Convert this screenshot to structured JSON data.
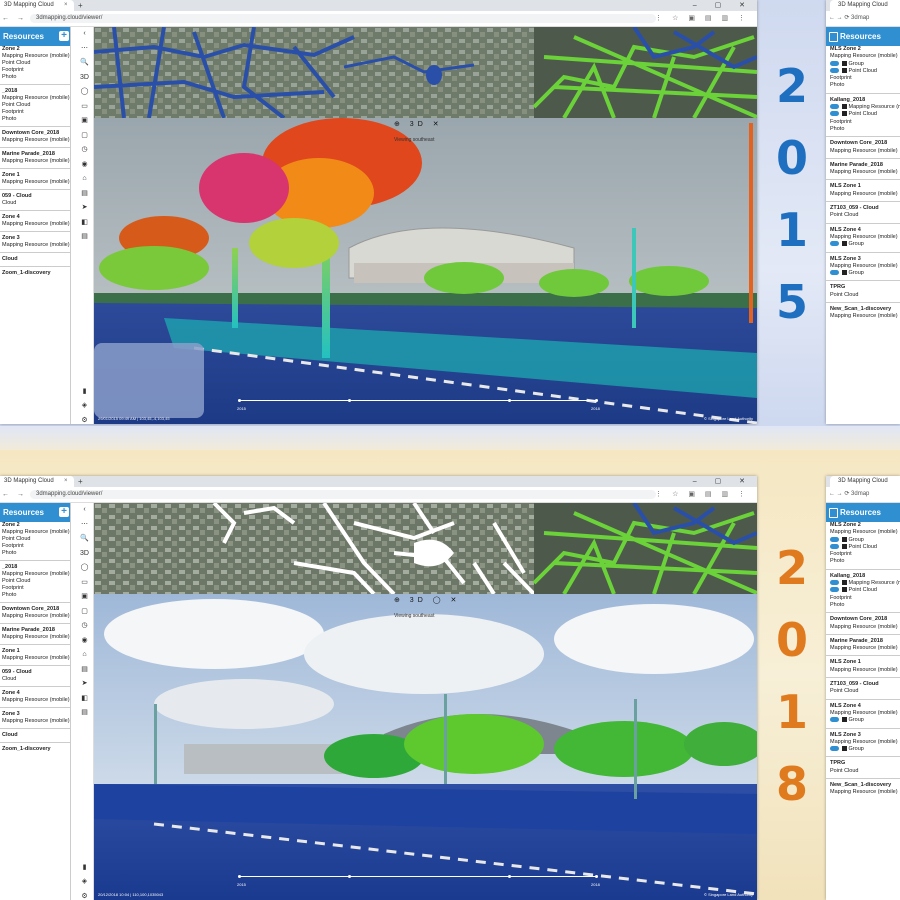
{
  "browser": {
    "tab_title": "3D Mapping Cloud",
    "tab_close": "×",
    "new_tab": "+",
    "window_controls": "– ▢ ✕",
    "nav_buttons": "← → ⟳",
    "url": "3dmapping.cloud/viewer/",
    "extension_icons": "⋮ ☆ ▣ ▤ ▥ ⋮"
  },
  "right_browser": {
    "tab_title": "3D Mapping Cloud",
    "nav_buttons": "← → ⟳",
    "url": "3dmap"
  },
  "left_panel": {
    "header": "Resources",
    "add_button": "+",
    "items": [
      "Zone 2",
      "Mapping Resource (mobile)",
      "Point Cloud",
      "Footprint",
      "Photo",
      "_2018",
      "Mapping Resource (mobile)",
      "Point Cloud",
      "Footprint",
      "Photo",
      "Downtown Core_2018",
      "Mapping Resource (mobile)",
      "Marine Parade_2018",
      "Mapping Resource (mobile)",
      "Zone 1",
      "Mapping Resource (mobile)",
      "059 - Cloud",
      "Cloud",
      "Zone 4",
      "Mapping Resource (mobile)",
      "Zone 3",
      "Mapping Resource (mobile)",
      "Cloud",
      "Zoom_1-discovery"
    ]
  },
  "toolbar": {
    "items": [
      "‹",
      "⋯",
      "🔍",
      "3D",
      "◯",
      "▭",
      "▣",
      "▢",
      "◷",
      "◉",
      "⌂",
      "▤",
      "➤",
      "◧",
      "▤"
    ],
    "bottom_items": [
      "▮",
      "◈",
      "⚙",
      "▯"
    ]
  },
  "views": [
    {
      "year_digits": [
        "2",
        "0",
        "1",
        "5"
      ],
      "year_color": "#1f6fc0",
      "view_controls": "⊕  3D  ✕",
      "view_label": "Viewing southeast",
      "timeline_start": "2015",
      "timeline_end": "2018",
      "timestamp": "29/01/2015 09:49 AM | 103,45,-4,103,45",
      "copyright": "© Singapore Land Authority"
    },
    {
      "year_digits": [
        "2",
        "0",
        "1",
        "8"
      ],
      "year_color": "#e07a1f",
      "view_controls": "⊕  3D  ◯  ✕",
      "view_label": "Viewing southeast",
      "timeline_start": "2015",
      "timeline_end": "2018",
      "timestamp": "20/12/2018 10:04 | 110,100,1035043",
      "copyright": "© Singapore Land Authority"
    }
  ],
  "right_panel": {
    "header": "Resources",
    "items": [
      "MLS Zone 2",
      "Mapping Resource (mobile)",
      "Group",
      "Point Cloud",
      "Footprint",
      "Photo",
      "Kallang_2018",
      "Mapping Resource (mobile)",
      "Point Cloud",
      "Footprint",
      "Photo",
      "Downtown Core_2018",
      "Mapping Resource (mobile)",
      "Marine Parade_2018",
      "Mapping Resource (mobile)",
      "MLS Zone 1",
      "Mapping Resource (mobile)",
      "ZT103_059 - Cloud",
      "Point Cloud",
      "MLS Zone 4",
      "Mapping Resource (mobile)",
      "Group",
      "MLS Zone 3",
      "Mapping Resource (mobile)",
      "Group",
      "TPRG",
      "Point Cloud",
      "New_Scan_1-discovery",
      "Mapping Resource (mobile)"
    ]
  },
  "colors": {
    "accent": "#2f8fd0",
    "road_2015": "#2a4fa8",
    "road_2018": "#ffffff",
    "road_new": "#6bd23a"
  }
}
